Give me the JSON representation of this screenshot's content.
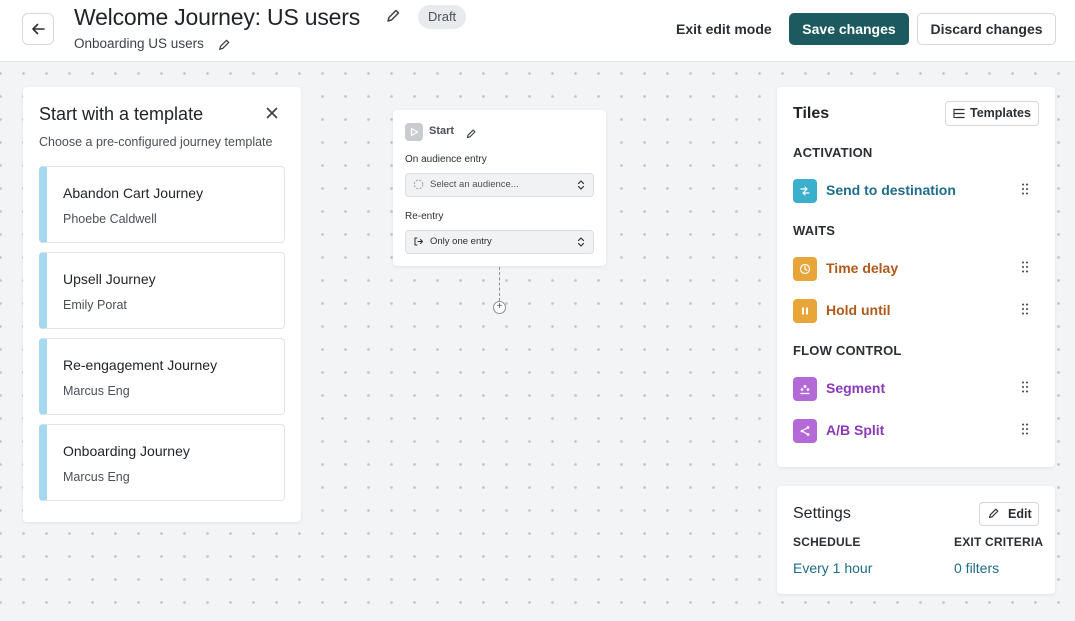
{
  "header": {
    "title": "Welcome Journey: US users",
    "status_badge": "Draft",
    "subtitle": "Onboarding US users",
    "exit_edit_label": "Exit edit mode",
    "save_label": "Save changes",
    "discard_label": "Discard changes"
  },
  "template_panel": {
    "title": "Start with a template",
    "description": "Choose a pre-configured journey template",
    "templates": [
      {
        "name": "Abandon Cart Journey",
        "author": "Phoebe Caldwell"
      },
      {
        "name": "Upsell Journey",
        "author": "Emily Porat"
      },
      {
        "name": "Re-engagement Journey",
        "author": "Marcus Eng"
      },
      {
        "name": "Onboarding Journey",
        "author": "Marcus Eng"
      }
    ]
  },
  "start_node": {
    "label": "Start",
    "audience_label": "On audience entry",
    "audience_placeholder": "Select an audience...",
    "reentry_label": "Re-entry",
    "reentry_value": "Only one entry"
  },
  "tiles_panel": {
    "title": "Tiles",
    "templates_button": "Templates",
    "sections": [
      {
        "header": "ACTIVATION",
        "tiles": [
          {
            "label": "Send to destination",
            "icon": "destination-icon",
            "color": "#1d6c8a",
            "bg": "#3ab0cc"
          }
        ]
      },
      {
        "header": "WAITS",
        "tiles": [
          {
            "label": "Time delay",
            "icon": "clock-icon",
            "color": "#b05a1a",
            "bg": "#e8a63a"
          },
          {
            "label": "Hold until",
            "icon": "pause-icon",
            "color": "#b05a1a",
            "bg": "#e8a63a"
          }
        ]
      },
      {
        "header": "FLOW CONTROL",
        "tiles": [
          {
            "label": "Segment",
            "icon": "segment-icon",
            "color": "#8a3ab8",
            "bg": "#b36ad6"
          },
          {
            "label": "A/B Split",
            "icon": "split-icon",
            "color": "#8a3ab8",
            "bg": "#b36ad6"
          }
        ]
      }
    ]
  },
  "settings_panel": {
    "title": "Settings",
    "edit_label": "Edit",
    "schedule_header": "SCHEDULE",
    "schedule_value": "Every 1 hour",
    "exit_header": "EXIT CRITERIA",
    "exit_value": "0 filters"
  }
}
